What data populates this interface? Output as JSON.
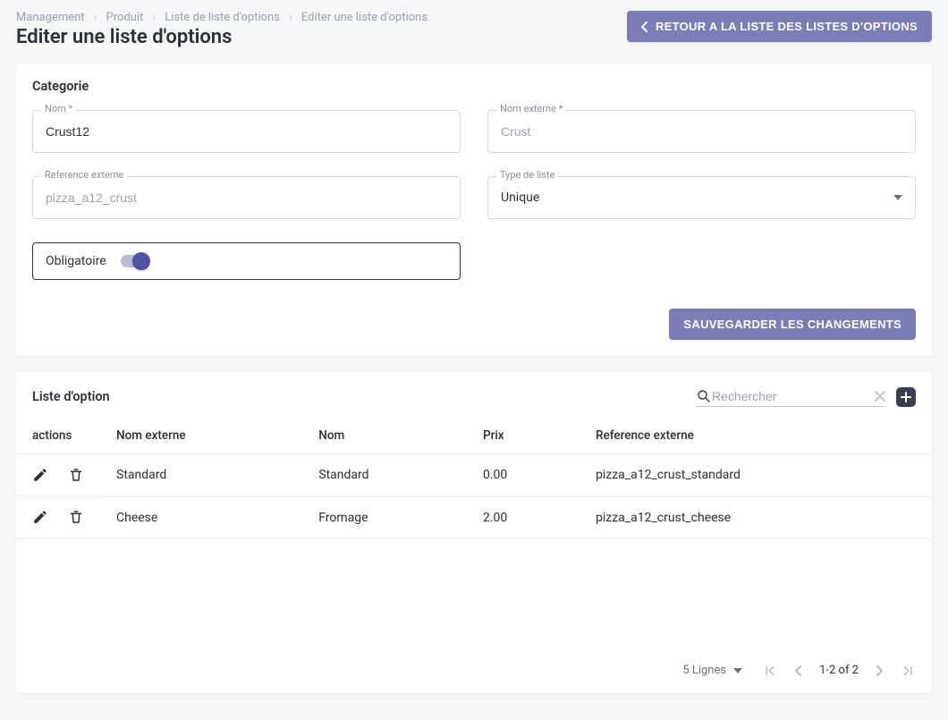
{
  "breadcrumb": {
    "items": [
      "Management",
      "Produit",
      "Liste de liste d'options",
      "Editer une liste d'options"
    ]
  },
  "header": {
    "title": "Editer une liste d'options",
    "back_button": "RETOUR A LA LISTE DES LISTES D'OPTIONS"
  },
  "category_card": {
    "title": "Categorie",
    "nom_label": "Nom *",
    "nom_value": "Crust12",
    "nom_externe_label": "Nom externe *",
    "nom_externe_value": "Crust",
    "ref_externe_label": "Reference externe",
    "ref_externe_value": "pizza_a12_crust",
    "type_liste_label": "Type de liste",
    "type_liste_value": "Unique",
    "obligatoire_label": "Obligatoire",
    "save_button": "SAUVEGARDER LES CHANGEMENTS"
  },
  "options_card": {
    "title": "Liste d'option",
    "search_placeholder": "Rechercher",
    "columns": {
      "actions": "actions",
      "nom_externe": "Nom externe",
      "nom": "Nom",
      "prix": "Prix",
      "ref_externe": "Reference externe"
    },
    "rows": [
      {
        "nom_externe": "Standard",
        "nom": "Standard",
        "prix": "0.00",
        "ref_externe": "pizza_a12_crust_standard"
      },
      {
        "nom_externe": "Cheese",
        "nom": "Fromage",
        "prix": "2.00",
        "ref_externe": "pizza_a12_crust_cheese"
      }
    ],
    "footer": {
      "rows_label": "5 Lignes",
      "page_range": "1-2 of 2"
    }
  }
}
